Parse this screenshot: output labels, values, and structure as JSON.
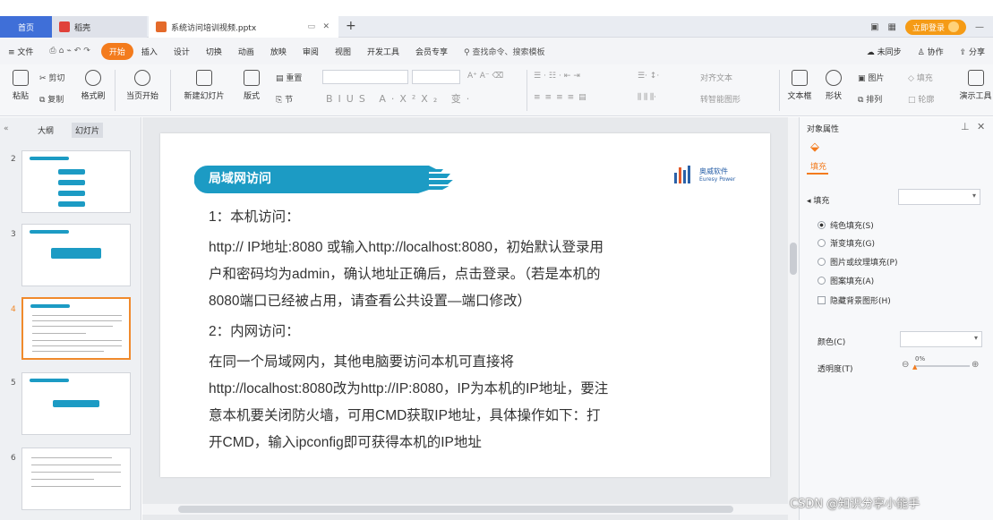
{
  "tabs": {
    "home": "首页",
    "wps": "稻壳",
    "doc": "系统访问培训视频.pptx"
  },
  "titlebar": {
    "login": "立即登录",
    "win_min": "—"
  },
  "menu": {
    "file": "≡ 文件",
    "items": [
      "开始",
      "插入",
      "设计",
      "切换",
      "动画",
      "放映",
      "审阅",
      "视图",
      "开发工具",
      "会员专享"
    ],
    "search": "查找命令、搜索模板",
    "sync": "未同步",
    "collab": "协作",
    "share": "分享"
  },
  "toolbar": {
    "paste": "粘贴",
    "cut": "剪切",
    "copy": "复制",
    "format": "格式刷",
    "start_from": "当页开始",
    "new_slide": "新建幻灯片",
    "layout": "版式",
    "section": "节",
    "reset": "重置",
    "textbox": "文本框",
    "shape": "形状",
    "picture": "图片",
    "arrange": "排列",
    "fill": "填充",
    "outline": "轮廓",
    "present": "演示工具",
    "align_text": "对齐文本",
    "smart": "转智能图形"
  },
  "left": {
    "tab_outline": "大纲",
    "tab_slides": "幻灯片",
    "nums": [
      "2",
      "3",
      "4",
      "5",
      "6"
    ]
  },
  "slide": {
    "title": "局域网访问",
    "logo_name": "奥威软件",
    "logo_sub": "Euresy Power",
    "lines": [
      "1：本机访问：",
      "http:// IP地址:8080 或输入http://localhost:8080，初始默认登录用",
      "户和密码均为admin，确认地址正确后，点击登录。（若是本机的",
      "8080端口已经被占用，请查看公共设置—端口修改）",
      "2：内网访问：",
      " 在同一个局域网内，其他电脑要访问本机可直接将",
      "http://localhost:8080改为http://IP:8080，IP为本机的IP地址，要注",
      "意本机要关闭防火墙，可用CMD获取IP地址，具体操作如下：打",
      "开CMD，输入ipconfig即可获得本机的IP地址"
    ]
  },
  "right": {
    "header": "对象属性",
    "tab_fill": "填充",
    "section_fill": "填充",
    "options": [
      "纯色填充(S)",
      "渐变填充(G)",
      "图片或纹理填充(P)",
      "图案填充(A)"
    ],
    "hide_bg": "隐藏背景图形(H)",
    "color_label": "颜色(C)",
    "transparency_label": "透明度(T)",
    "transparency_value": "0%"
  },
  "watermark": "CSDN @知识分享小能手",
  "colors": {
    "accent": "#f37b1d",
    "banner": "#1c9bc4",
    "home_tab": "#3f6fd8"
  }
}
